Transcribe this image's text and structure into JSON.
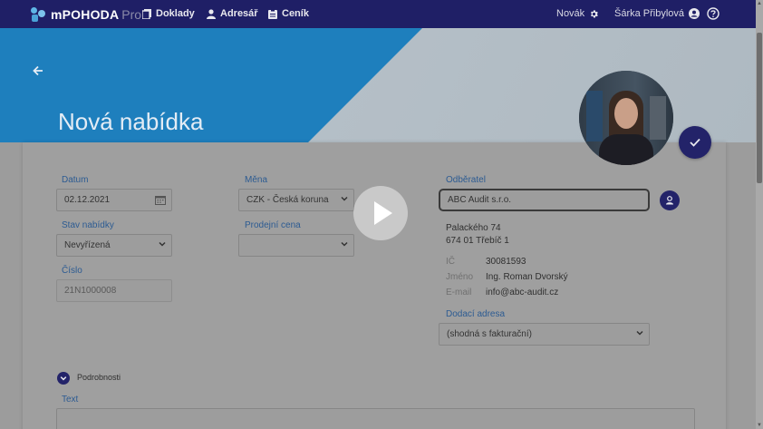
{
  "nav": {
    "brand_name": "mPOHODA",
    "brand_suffix": "Pro",
    "items": [
      {
        "label": "Doklady",
        "icon": "documents-icon"
      },
      {
        "label": "Adresář",
        "icon": "person-icon"
      },
      {
        "label": "Ceník",
        "icon": "clipboard-icon"
      }
    ],
    "company": "Novák",
    "user": "Šárka Přibylová"
  },
  "header": {
    "title": "Nová nabídka"
  },
  "form": {
    "datum_label": "Datum",
    "datum_value": "02.12.2021",
    "stav_label": "Stav nabídky",
    "stav_value": "Nevyřízená",
    "cislo_label": "Číslo",
    "cislo_value": "21N1000008",
    "mena_label": "Měna",
    "mena_value": "CZK - Česká koruna",
    "prodejni_label": "Prodejní cena",
    "prodejni_value": "",
    "odberatel_label": "Odběratel",
    "odberatel_value": "ABC Audit s.r.o.",
    "address_line1": "Palackého 74",
    "address_line2": "674 01 Třebíč 1",
    "ic_label": "IČ",
    "ic_value": "30081593",
    "jmeno_label": "Jméno",
    "jmeno_value": "Ing. Roman Dvorský",
    "email_label": "E-mail",
    "email_value": "info@abc-audit.cz",
    "dodaci_label": "Dodací adresa",
    "dodaci_value": "(shodná s fakturační)",
    "podrobnosti_label": "Podrobnosti",
    "text_label": "Text"
  },
  "colors": {
    "nav_bg": "#1f1f66",
    "banner_blue": "#1e7fbd",
    "label_blue": "#2c5b92",
    "accent_button": "#232369"
  }
}
